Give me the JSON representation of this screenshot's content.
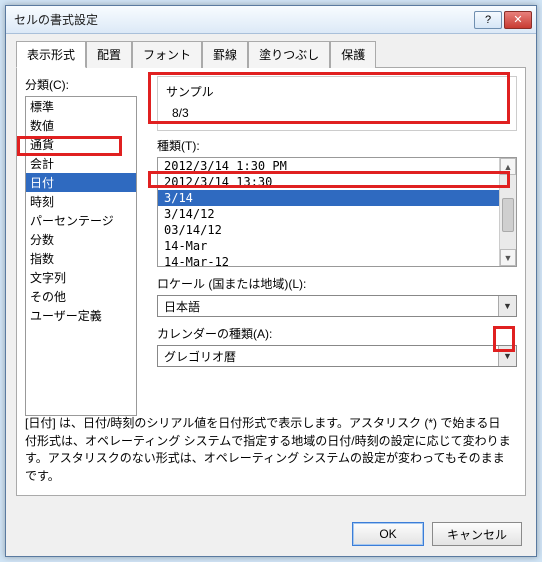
{
  "window": {
    "title": "セルの書式設定"
  },
  "tabs": [
    "表示形式",
    "配置",
    "フォント",
    "罫線",
    "塗りつぶし",
    "保護"
  ],
  "active_tab": 0,
  "category": {
    "label": "分類(C):",
    "items": [
      "標準",
      "数値",
      "通貨",
      "会計",
      "日付",
      "時刻",
      "パーセンテージ",
      "分数",
      "指数",
      "文字列",
      "その他",
      "ユーザー定義"
    ],
    "selected_index": 4
  },
  "sample": {
    "label": "サンプル",
    "value": "8/3"
  },
  "type": {
    "label": "種類(T):",
    "items": [
      "2012/3/14 1:30 PM",
      "2012/3/14 13:30",
      "3/14",
      "3/14/12",
      "03/14/12",
      "14-Mar",
      "14-Mar-12"
    ],
    "selected_index": 2
  },
  "locale": {
    "label": "ロケール (国または地域)(L):",
    "value": "日本語"
  },
  "calendar": {
    "label": "カレンダーの種類(A):",
    "value": "グレゴリオ暦"
  },
  "description": "[日付] は、日付/時刻のシリアル値を日付形式で表示します。アスタリスク (*) で始まる日付形式は、オペレーティング システムで指定する地域の日付/時刻の設定に応じて変わります。アスタリスクのない形式は、オペレーティング システムの設定が変わってもそのままです。",
  "buttons": {
    "ok": "OK",
    "cancel": "キャンセル"
  }
}
